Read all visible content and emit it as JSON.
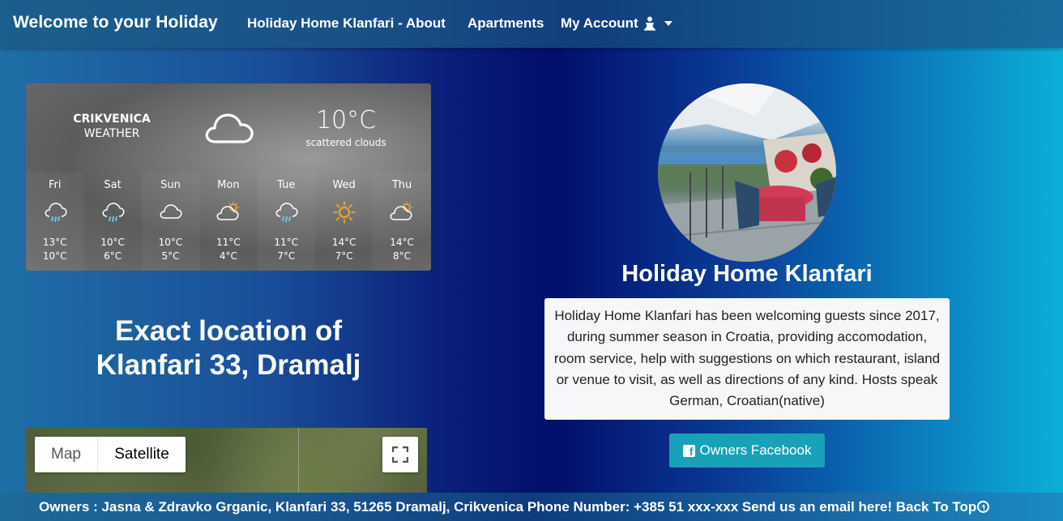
{
  "navbar": {
    "brand": "Welcome to your Holiday",
    "links": [
      {
        "label": "Holiday Home Klanfari - About"
      },
      {
        "label": "Apartments"
      },
      {
        "label": "My Account",
        "icon": "person-icon",
        "has_dropdown": true
      }
    ]
  },
  "weather": {
    "city": "CRIKVENICA",
    "label": "WEATHER",
    "temperature": "10°C",
    "description": "scattered clouds",
    "current_icon": "cloud-icon",
    "forecast": [
      {
        "day": "Fri",
        "icon": "rain-icon",
        "high": "13°C",
        "low": "10°C"
      },
      {
        "day": "Sat",
        "icon": "rain-icon",
        "high": "10°C",
        "low": "6°C"
      },
      {
        "day": "Sun",
        "icon": "cloud-icon",
        "high": "10°C",
        "low": "5°C"
      },
      {
        "day": "Mon",
        "icon": "partly-sunny-icon",
        "high": "11°C",
        "low": "4°C"
      },
      {
        "day": "Tue",
        "icon": "rain-icon",
        "high": "11°C",
        "low": "7°C"
      },
      {
        "day": "Wed",
        "icon": "sun-icon",
        "high": "14°C",
        "low": "7°C"
      },
      {
        "day": "Thu",
        "icon": "partly-sunny-icon",
        "high": "14°C",
        "low": "8°C"
      }
    ]
  },
  "location": {
    "title_line1": "Exact location of",
    "title_line2": "Klanfari 33, Dramalj"
  },
  "map": {
    "map_option": "Map",
    "satellite_option": "Satellite",
    "selected": "Satellite"
  },
  "home": {
    "title": "Holiday Home Klanfari",
    "description": "Holiday Home Klanfari has been welcoming guests since 2017, during summer season in Croatia, providing accomodation, room service, help with suggestions on which restaurant, island or venue to visit, as well as directions of any kind. Hosts speak German, Croatian(native)",
    "facebook_label": "Owners Facebook"
  },
  "footer": {
    "text": "Owners : Jasna & Zdravko Grganic, Klanfari 33, 51265 Dramalj, Crikvenica Phone Number: +385 51 xxx-xxx Send us an email here! Back To Top"
  },
  "colors": {
    "facebook_button": "#17a2b8",
    "card_background": "#f6f7f9"
  }
}
